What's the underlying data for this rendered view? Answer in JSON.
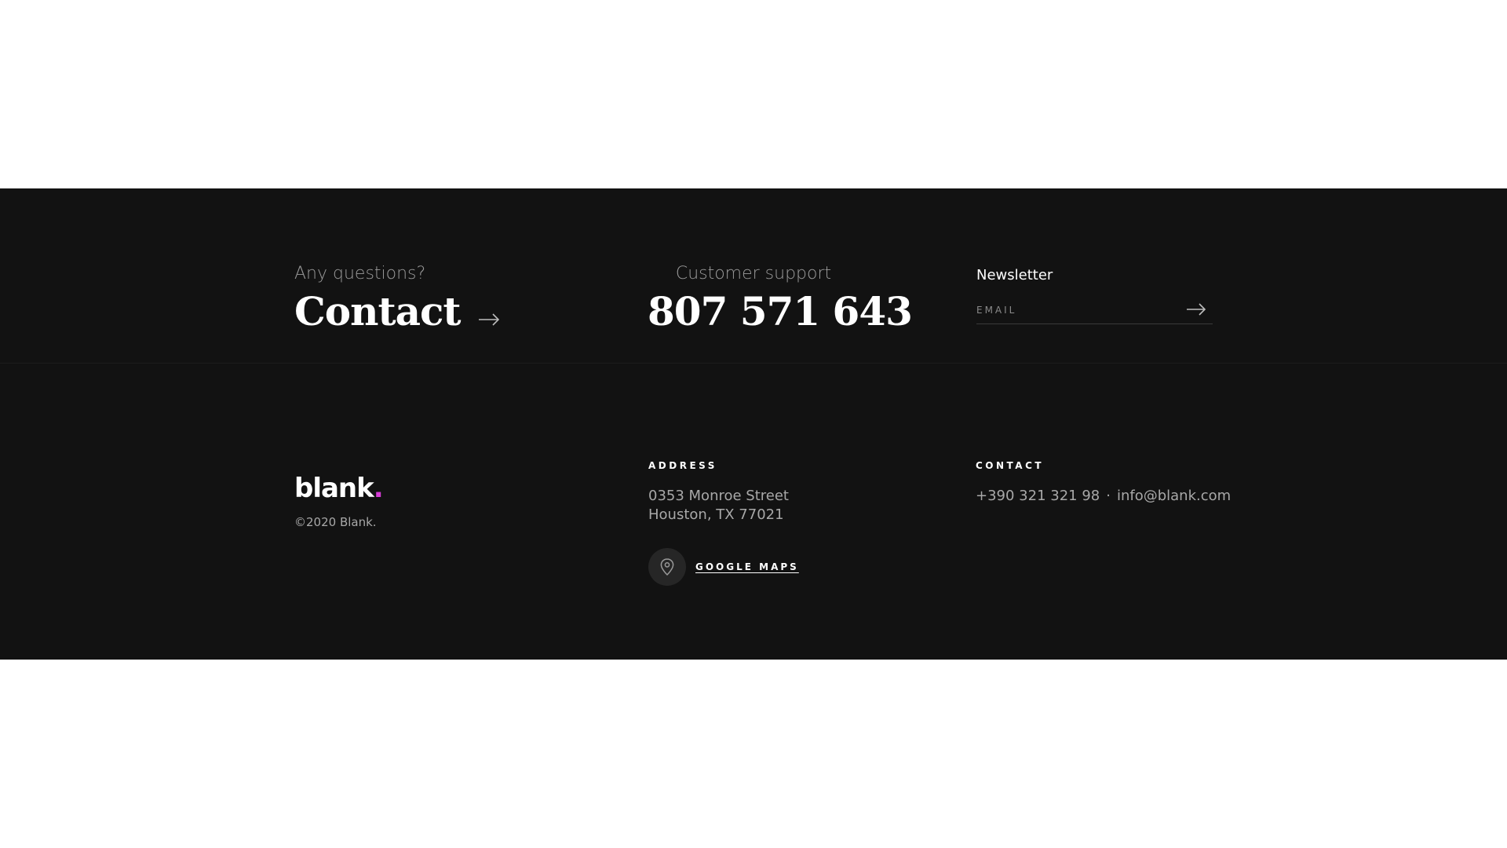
{
  "cta": {
    "questions_label": "Any questions?",
    "contact_label": "Contact"
  },
  "support": {
    "label": "Customer support",
    "phone": "807 571 643"
  },
  "newsletter": {
    "title": "Newsletter",
    "email_placeholder": "EMAIL"
  },
  "brand": {
    "logo_text": "blank",
    "logo_dot": ".",
    "copyright": "©2020 Blank."
  },
  "address": {
    "heading": "ADDRESS",
    "line1": "0353 Monroe Street",
    "line2": "Houston, TX 77021",
    "map_link": "GOOGLE MAPS"
  },
  "contact": {
    "heading": "CONTACT",
    "phone": "+390 321 321 98",
    "separator": "·",
    "email": "info@blank.com"
  },
  "colors": {
    "footer_bg": "#121212",
    "accent_dot": "#d63cd6"
  }
}
